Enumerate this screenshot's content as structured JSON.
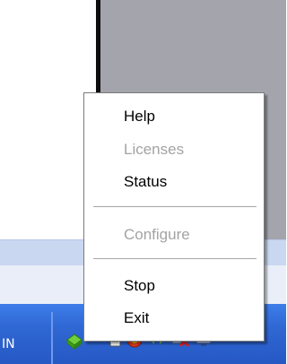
{
  "context_menu": {
    "items": [
      {
        "label": "Help",
        "enabled": true
      },
      {
        "label": "Licenses",
        "enabled": false
      },
      {
        "label": "Status",
        "enabled": true
      },
      {
        "label": "Configure",
        "enabled": false
      },
      {
        "label": "Stop",
        "enabled": true
      },
      {
        "label": "Exit",
        "enabled": true
      }
    ]
  },
  "taskbar": {
    "partial_text": "IN",
    "tray_icons": [
      "app-cube-icon",
      "document-icon",
      "shield-icon",
      "network-activity-icon",
      "network-disconnected-icon",
      "monitor-icon"
    ]
  },
  "colors": {
    "taskbar_blue": "#2f67d3",
    "menu_disabled_text": "#a3a3a3"
  }
}
